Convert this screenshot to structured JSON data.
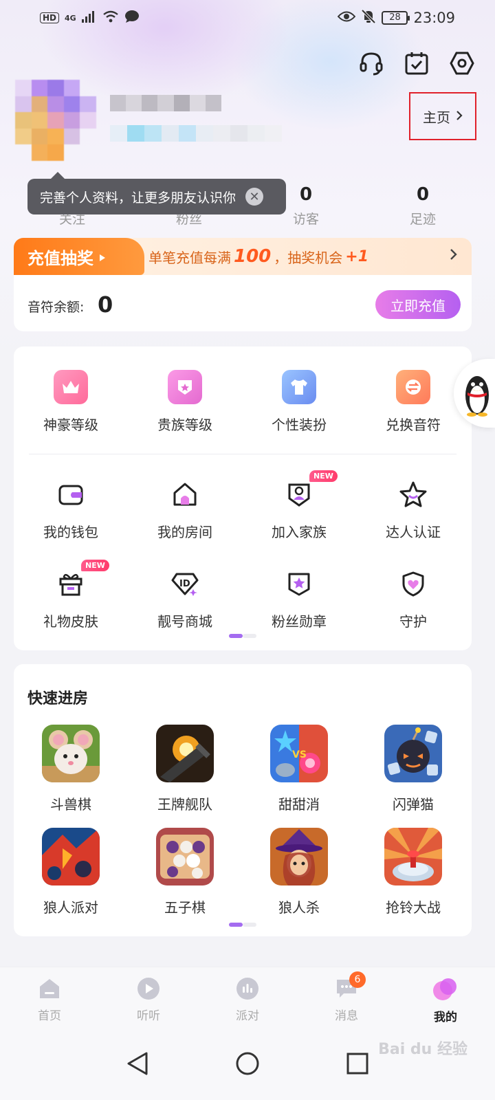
{
  "status_bar": {
    "network_badge": "HD",
    "signal_label": "4G",
    "battery": "28",
    "time": "23:09"
  },
  "header": {
    "icons": [
      "headset-icon",
      "calendar-check-icon",
      "settings-hex-icon"
    ],
    "home_link": "主页"
  },
  "tooltip": {
    "text": "完善个人资料，让更多朋友认识你",
    "close": "✕"
  },
  "stats": [
    {
      "value": "",
      "label": "关注"
    },
    {
      "value": "",
      "label": "粉丝"
    },
    {
      "value": "0",
      "label": "访客"
    },
    {
      "value": "0",
      "label": "足迹"
    }
  ],
  "promo": {
    "tag": "充值抽奖",
    "text_before": "单笔充值每满",
    "amount": "100",
    "text_middle": "，抽奖机会",
    "bonus": "+1"
  },
  "balance": {
    "label": "音符余额:",
    "value": "0",
    "recharge_button": "立即充值"
  },
  "features_top": [
    {
      "label": "神豪等级",
      "icon": "crown-icon",
      "color": "#ff7aa8"
    },
    {
      "label": "贵族等级",
      "icon": "noble-badge-icon",
      "color": "#f57ad6"
    },
    {
      "label": "个性装扮",
      "icon": "tshirt-icon",
      "color": "#7aa8ff"
    },
    {
      "label": "兑换音符",
      "icon": "exchange-icon",
      "color": "#ff8a5a"
    }
  ],
  "features_row2": [
    {
      "label": "我的钱包",
      "icon": "wallet-icon",
      "badge": ""
    },
    {
      "label": "我的房间",
      "icon": "house-icon",
      "badge": ""
    },
    {
      "label": "加入家族",
      "icon": "family-shield-icon",
      "badge": "NEW"
    },
    {
      "label": "达人认证",
      "icon": "star-icon",
      "badge": ""
    }
  ],
  "features_row3": [
    {
      "label": "礼物皮肤",
      "icon": "gift-icon",
      "badge": "NEW"
    },
    {
      "label": "靓号商城",
      "icon": "id-diamond-icon",
      "badge": ""
    },
    {
      "label": "粉丝勋章",
      "icon": "star-badge-icon",
      "badge": ""
    },
    {
      "label": "守护",
      "icon": "heart-shield-icon",
      "badge": ""
    }
  ],
  "quick_enter": {
    "title": "快速进房",
    "row1": [
      "斗兽棋",
      "王牌舰队",
      "甜甜消",
      "闪弹猫"
    ],
    "row2": [
      "狼人派对",
      "五子棋",
      "狼人杀",
      "抢铃大战"
    ]
  },
  "bottom_nav": [
    {
      "label": "首页",
      "icon": "home-nav-icon"
    },
    {
      "label": "听听",
      "icon": "play-nav-icon"
    },
    {
      "label": "派对",
      "icon": "party-nav-icon"
    },
    {
      "label": "消息",
      "icon": "message-nav-icon",
      "badge": "6"
    },
    {
      "label": "我的",
      "icon": "me-nav-icon",
      "active": true
    }
  ],
  "accent_colors": {
    "primary": "#b560f0",
    "promo": "#ff7a18",
    "badge": "#ff6a2a"
  }
}
